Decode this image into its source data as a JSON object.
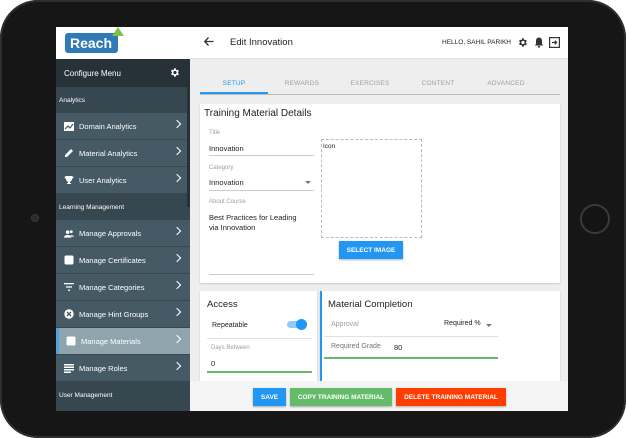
{
  "app": {
    "logo_text": "Reach"
  },
  "sidebar": {
    "header": "Configure Menu",
    "sections": [
      {
        "label": "Analytics",
        "items": [
          {
            "label": "Domain Analytics",
            "icon": "chart-icon"
          },
          {
            "label": "Material Analytics",
            "icon": "pencil-icon"
          },
          {
            "label": "User Analytics",
            "icon": "trophy-icon"
          }
        ]
      },
      {
        "label": "Learning Management",
        "items": [
          {
            "label": "Manage Approvals",
            "icon": "users-icon"
          },
          {
            "label": "Manage Certificates",
            "icon": "certificate-icon"
          },
          {
            "label": "Manage Categories",
            "icon": "filter-icon"
          },
          {
            "label": "Manage Hint Groups",
            "icon": "cancel-circle-icon"
          },
          {
            "label": "Manage Materials",
            "icon": "document-icon",
            "active": true
          },
          {
            "label": "Manage Roles",
            "icon": "list-icon"
          }
        ]
      },
      {
        "label": "User Management",
        "items": []
      }
    ]
  },
  "topbar": {
    "title": "Edit Innovation",
    "greeting": "HELLO, SAHIL PARIKH"
  },
  "tabs": [
    "SETUP",
    "REWARDS",
    "EXERCISES",
    "CONTENT",
    "ADVANCED"
  ],
  "active_tab": "SETUP",
  "details": {
    "heading": "Training Material Details",
    "title_label": "Title",
    "title_value": "Innovation",
    "category_label": "Category",
    "category_value": "Innovation",
    "about_label": "About Course",
    "about_value_line1": "Best Practices for Leading",
    "about_value_line2": "via Innovation",
    "icon_label": "Icon",
    "select_image": "SELECT IMAGE"
  },
  "access": {
    "heading": "Access",
    "repeatable_label": "Repeatable",
    "repeatable_on": true,
    "days_between_label": "Days Between",
    "days_between_value": "0"
  },
  "completion": {
    "heading": "Material Completion",
    "approval_label": "Approval",
    "approval_value": "Required %",
    "required_grade_label": "Required Grade",
    "required_grade_value": "80"
  },
  "actions": {
    "save": "SAVE",
    "copy": "COPY TRAINING MATERIAL",
    "delete": "DELETE TRAINING MATERIAL"
  },
  "colors": {
    "primary": "#2196f3",
    "success": "#66bb6a",
    "danger": "#ff3d00",
    "sidebar": "#37474f"
  }
}
